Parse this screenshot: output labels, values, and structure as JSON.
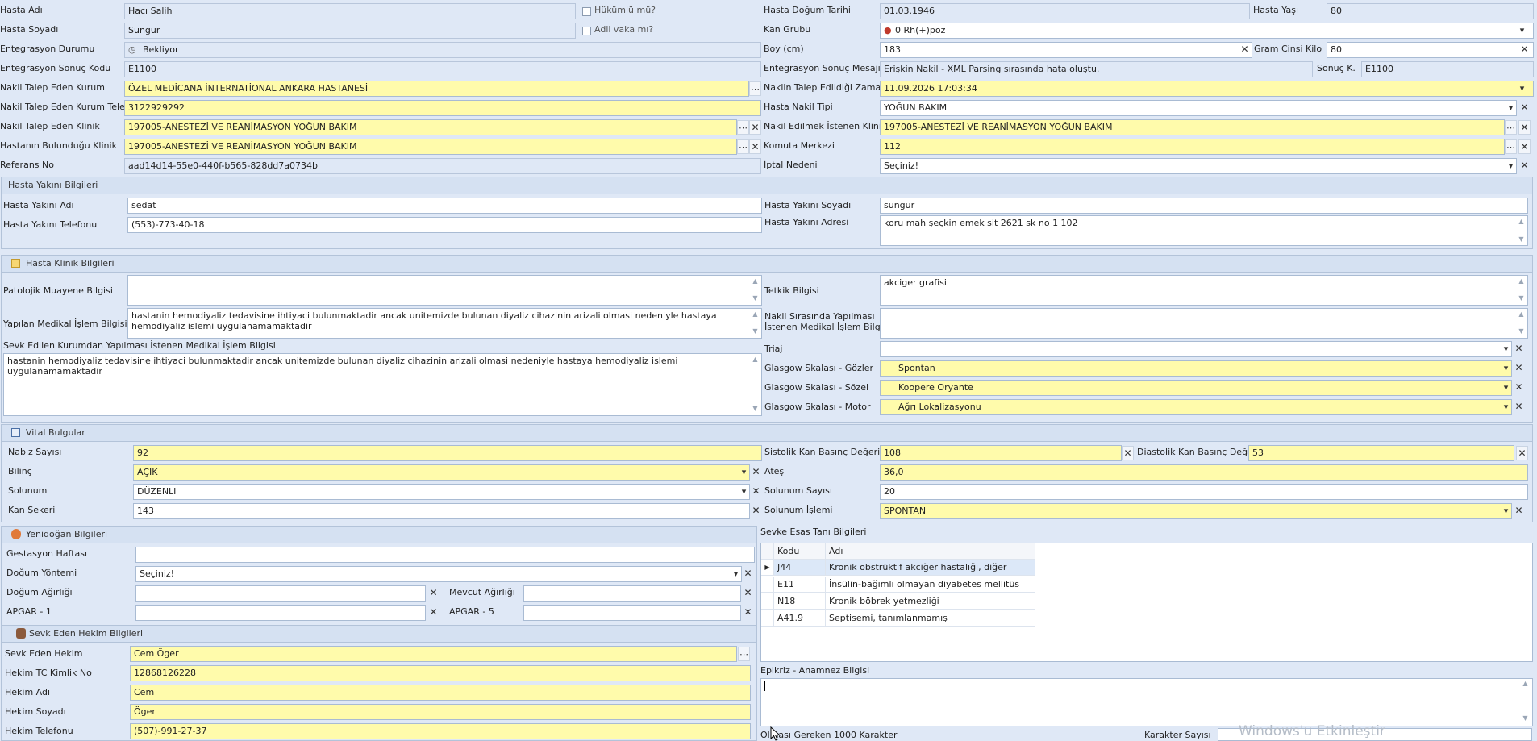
{
  "patient": {
    "hasta_adi_label": "Hasta Adı",
    "hasta_adi": "Hacı Salih",
    "hasta_soyadi_label": "Hasta Soyadı",
    "hasta_soyadi": "Sungur",
    "hukumlu_label": "Hükümlü mü?",
    "adli_label": "Adli vaka mı?",
    "dogum_tarihi_label": "Hasta Doğum Tarihi",
    "dogum_tarihi": "01.03.1946",
    "yas_label": "Hasta Yaşı",
    "yas": "80",
    "kan_grubu_label": "Kan Grubu",
    "kan_grubu": "0 Rh(+)poz",
    "entegrasyon_durumu_label": "Entegrasyon Durumu",
    "entegrasyon_durumu": "Bekliyor",
    "boy_label": "Boy (cm)",
    "boy": "183",
    "kilo_label": "Gram Cinsi Kilo",
    "kilo": "80",
    "sonuc_kodu_label": "Entegrasyon Sonuç Kodu",
    "sonuc_kodu": "E1100",
    "sonuc_mesaji_label": "Entegrasyon Sonuç Mesajı",
    "sonuc_mesaji": "Erişkin Nakil - XML Parsing sırasında hata oluştu.",
    "sonuc_k_label": "Sonuç K.",
    "sonuc_k": "E1100",
    "talep_kurum_label": "Nakil Talep Eden Kurum",
    "talep_kurum": "ÖZEL MEDİCANA İNTERNATİONAL ANKARA HASTANESİ",
    "talep_zaman_label": "Naklin Talep Edildiği Zaman",
    "talep_zaman": "11.09.2026 17:03:34",
    "kurum_tel_label": "Nakil Talep Eden Kurum Telefon",
    "kurum_tel": "3122929292",
    "nakil_tipi_label": "Hasta Nakil Tipi",
    "nakil_tipi": "YOĞUN BAKIM",
    "talep_klinik_label": "Nakil Talep Eden Klinik",
    "talep_klinik": "197005-ANESTEZİ VE REANİMASYON YOĞUN BAKIM",
    "istenen_klinik_label": "Nakil Edilmek İstenen Klinik",
    "istenen_klinik": "197005-ANESTEZİ VE REANİMASYON YOĞUN BAKIM",
    "bulundugu_klinik_label": "Hastanın Bulunduğu Klinik",
    "bulundugu_klinik": "197005-ANESTEZİ VE REANİMASYON YOĞUN BAKIM",
    "komuta_label": "Komuta Merkezi",
    "komuta": "112",
    "referans_label": "Referans No",
    "referans": "aad14d14-55e0-440f-b565-828dd7a0734b",
    "iptal_label": "İptal Nedeni",
    "iptal": "Seçiniz!"
  },
  "yakini": {
    "title": "Hasta Yakını Bilgileri",
    "adi_label": "Hasta Yakını Adı",
    "adi": "sedat",
    "soyadi_label": "Hasta Yakını Soyadı",
    "soyadi": "sungur",
    "tel_label": "Hasta Yakını Telefonu",
    "tel": "(553)-773-40-18",
    "adres_label": "Hasta Yakını Adresi",
    "adres": "koru mah şeçkin emek sit 2621 sk no 1 102"
  },
  "klinik": {
    "title": "Hasta Klinik Bilgileri",
    "patolojik_label": "Patolojik Muayene Bilgisi",
    "patolojik": "",
    "tetkik_label": "Tetkik Bilgisi",
    "tetkik": "akciger grafisi",
    "medikal_label": "Yapılan Medikal İşlem Bilgisi",
    "medikal": "hastanin hemodiyaliz tedavisine ihtiyaci bulunmaktadir ancak unitemizde bulunan diyaliz cihazinin arizali olmasi nedeniyle hastaya hemodiyaliz islemi uygulanamamaktadir",
    "nakil_sirasinda_label1": "Nakil Sırasında Yapılması",
    "nakil_sirasinda_label2": "İstenen Medikal İşlem Bilgisi",
    "nakil_sirasinda": "",
    "sevk_label": "Sevk Edilen Kurumdan Yapılması İstenen Medikal İşlem Bilgisi",
    "sevk": "hastanin hemodiyaliz tedavisine ihtiyaci bulunmaktadir ancak unitemizde bulunan diyaliz cihazinin arizali olmasi nedeniyle hastaya hemodiyaliz islemi uygulanamamaktadir",
    "triaj_label": "Triaj",
    "triaj": "",
    "gozler_label": "Glasgow Skalası - Gözler",
    "gozler": "Spontan",
    "sozel_label": "Glasgow Skalası - Sözel",
    "sozel": "Koopere Oryante",
    "motor_label": "Glasgow Skalası - Motor",
    "motor": "Ağrı Lokalizasyonu"
  },
  "vital": {
    "title": "Vital Bulgular",
    "nabiz_label": "Nabız Sayısı",
    "nabiz": "92",
    "sistolik_label": "Sistolik Kan Basınç Değeri",
    "sistolik": "108",
    "diastolik_label": "Diastolik Kan Basınç Değeri",
    "diastolik": "53",
    "bilinc_label": "Bilinç",
    "bilinc": "AÇIK",
    "ates_label": "Ateş",
    "ates": "36,0",
    "solunum_label": "Solunum",
    "solunum": "DÜZENLI",
    "solunum_sayisi_label": "Solunum Sayısı",
    "solunum_sayisi": "20",
    "kan_sekeri_label": "Kan Şekeri",
    "kan_sekeri": "143",
    "solunum_islemi_label": "Solunum İşlemi",
    "solunum_islemi": "SPONTAN"
  },
  "yenidogan": {
    "title": "Yenidoğan Bilgileri",
    "gestasyon_label": "Gestasyon Haftası",
    "gestasyon": "",
    "dogum_yontemi_label": "Doğum Yöntemi",
    "dogum_yontemi": "Seçiniz!",
    "dogum_agirligi_label": "Doğum Ağırlığı",
    "dogum_agirligi": "",
    "mevcut_agirlik_label": "Mevcut Ağırlığı",
    "mevcut_agirlik": "",
    "apgar1_label": "APGAR - 1",
    "apgar1": "",
    "apgar5_label": "APGAR - 5",
    "apgar5": ""
  },
  "hekim": {
    "title": "Sevk Eden Hekim Bilgileri",
    "hekim_label": "Sevk Eden Hekim",
    "hekim": "Cem Öger",
    "tc_label": "Hekim TC Kimlik No",
    "tc": "12868126228",
    "adi_label": "Hekim Adı",
    "adi": "Cem",
    "soyadi_label": "Hekim Soyadı",
    "soyadi": "Öger",
    "tel_label": "Hekim Telefonu",
    "tel": "(507)-991-27-37"
  },
  "tani": {
    "title": "Sevke Esas Tanı Bilgileri",
    "col_kodu": "Kodu",
    "col_adi": "Adı",
    "rows": [
      {
        "kodu": "J44",
        "adi": "Kronik obstrüktif akciğer hastalığı, diğer"
      },
      {
        "kodu": "E11",
        "adi": "İnsülin-bağımlı olmayan diyabetes mellitüs"
      },
      {
        "kodu": "N18",
        "adi": "Kronik böbrek yetmezliği"
      },
      {
        "kodu": "A41.9",
        "adi": "Septisemi, tanımlanmamış"
      }
    ]
  },
  "epikriz": {
    "label": "Epikriz - Anamnez Bilgisi",
    "value": "",
    "footer_left": "Olması Gereken 1000 Karakter",
    "karakter_label": "Karakter Sayısı",
    "watermark": "Windows'u Etkinleştir"
  },
  "icons": {
    "dropdown": "chevron-down-icon",
    "ellipsis": "ellipsis-icon",
    "clear": "close-icon",
    "clock": "clock-icon",
    "blood": "blood-drop-icon"
  },
  "colors": {
    "background": "#dfe8f6",
    "required": "#fffbab",
    "border": "#a9bbd3"
  }
}
